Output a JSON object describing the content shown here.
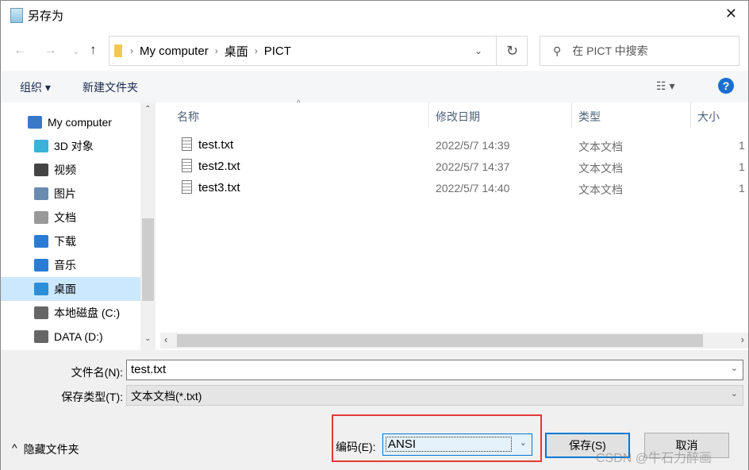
{
  "window": {
    "title": "另存为"
  },
  "address": {
    "crumbs": [
      "My computer",
      "桌面",
      "PICT"
    ]
  },
  "search": {
    "placeholder": "在 PICT 中搜索"
  },
  "toolbar": {
    "organize": "组织 ▾",
    "new_folder": "新建文件夹"
  },
  "sidebar": {
    "items": [
      {
        "label": "My computer",
        "icon": "computer-icon",
        "color": "#3a78c8"
      },
      {
        "label": "3D 对象",
        "icon": "cube-icon",
        "color": "#3bb0d8"
      },
      {
        "label": "视频",
        "icon": "video-icon",
        "color": "#444"
      },
      {
        "label": "图片",
        "icon": "picture-icon",
        "color": "#6a8bb0"
      },
      {
        "label": "文档",
        "icon": "document-icon",
        "color": "#999"
      },
      {
        "label": "下载",
        "icon": "download-icon",
        "color": "#2a7bd5"
      },
      {
        "label": "音乐",
        "icon": "music-icon",
        "color": "#2a7bd5"
      },
      {
        "label": "桌面",
        "icon": "desktop-icon",
        "color": "#2a8fd8",
        "selected": true
      },
      {
        "label": "本地磁盘 (C:)",
        "icon": "drive-icon",
        "color": "#666"
      },
      {
        "label": "DATA (D:)",
        "icon": "drive-icon",
        "color": "#666"
      }
    ]
  },
  "columns": [
    "名称",
    "修改日期",
    "类型",
    "大小"
  ],
  "files": [
    {
      "name": "test.txt",
      "date": "2022/5/7 14:39",
      "type": "文本文档",
      "size": "1"
    },
    {
      "name": "test2.txt",
      "date": "2022/5/7 14:37",
      "type": "文本文档",
      "size": "1"
    },
    {
      "name": "test3.txt",
      "date": "2022/5/7 14:40",
      "type": "文本文档",
      "size": "1"
    }
  ],
  "form": {
    "filename_label": "文件名(N):",
    "filename": "test.txt",
    "type_label": "保存类型(T):",
    "type": "文本文档(*.txt)",
    "encoding_label": "编码(E):",
    "encoding": "ANSI"
  },
  "buttons": {
    "hide_folders": "隐藏文件夹",
    "save": "保存(S)",
    "cancel": "取消"
  },
  "watermark": "CSDN @牛石力醉画",
  "colors": {
    "highlight": "#e53935",
    "accent": "#0078d7"
  }
}
